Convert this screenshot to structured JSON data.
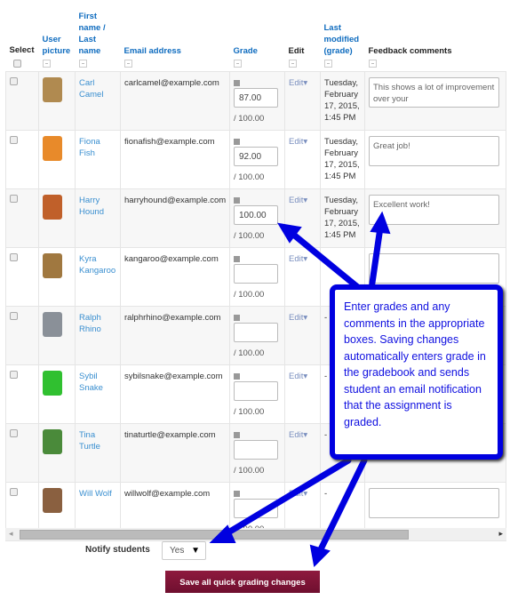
{
  "headers": {
    "select": "Select",
    "picture": "User picture",
    "name": "First name / Last name",
    "email": "Email address",
    "grade": "Grade",
    "edit": "Edit",
    "modified": "Last modified (grade)",
    "feedback": "Feedback comments"
  },
  "rows": [
    {
      "name": "Carl Camel",
      "email": "carlcamel@example.com",
      "grade": "87.00",
      "max": "/ 100.00",
      "edit": "Edit",
      "modified": "Tuesday, February 17, 2015, 1:45 PM",
      "feedback": "This shows a lot of improvement over your",
      "color": "#b08a50"
    },
    {
      "name": "Fiona Fish",
      "email": "fionafish@example.com",
      "grade": "92.00",
      "max": "/ 100.00",
      "edit": "Edit",
      "modified": "Tuesday, February 17, 2015, 1:45 PM",
      "feedback": "Great job!",
      "color": "#e88a2a"
    },
    {
      "name": "Harry Hound",
      "email": "harryhound@example.com",
      "grade": "100.00",
      "max": "/ 100.00",
      "edit": "Edit",
      "modified": "Tuesday, February 17, 2015, 1:45 PM",
      "feedback": "Excellent work!",
      "color": "#c0602a"
    },
    {
      "name": "Kyra Kangaroo",
      "email": "kangaroo@example.com",
      "grade": "",
      "max": "/ 100.00",
      "edit": "Edit",
      "modified": "-",
      "feedback": "",
      "color": "#a07840"
    },
    {
      "name": "Ralph Rhino",
      "email": "ralphrhino@example.com",
      "grade": "",
      "max": "/ 100.00",
      "edit": "Edit",
      "modified": "-",
      "feedback": "",
      "color": "#8a9098"
    },
    {
      "name": "Sybil Snake",
      "email": "sybilsnake@example.com",
      "grade": "",
      "max": "/ 100.00",
      "edit": "Edit",
      "modified": "-",
      "feedback": "",
      "color": "#30c030"
    },
    {
      "name": "Tina Turtle",
      "email": "tinaturtle@example.com",
      "grade": "",
      "max": "/ 100.00",
      "edit": "Edit",
      "modified": "-",
      "feedback": "",
      "color": "#4a8a3a"
    },
    {
      "name": "Will Wolf",
      "email": "willwolf@example.com",
      "grade": "",
      "max": "/ 100.00",
      "edit": "Edit",
      "modified": "-",
      "feedback": "",
      "color": "#8a6040"
    }
  ],
  "notify": {
    "label": "Notify students",
    "value": "Yes"
  },
  "save_label": "Save all quick grading changes",
  "callout": "Enter grades and any comments in the appropriate boxes. Saving changes automatically enters grade in the gradebook and sends student an email notification that the assignment is graded.",
  "colors": {
    "link": "#3a8fd0",
    "annotation": "#0000e0",
    "button": "#7d1435"
  }
}
